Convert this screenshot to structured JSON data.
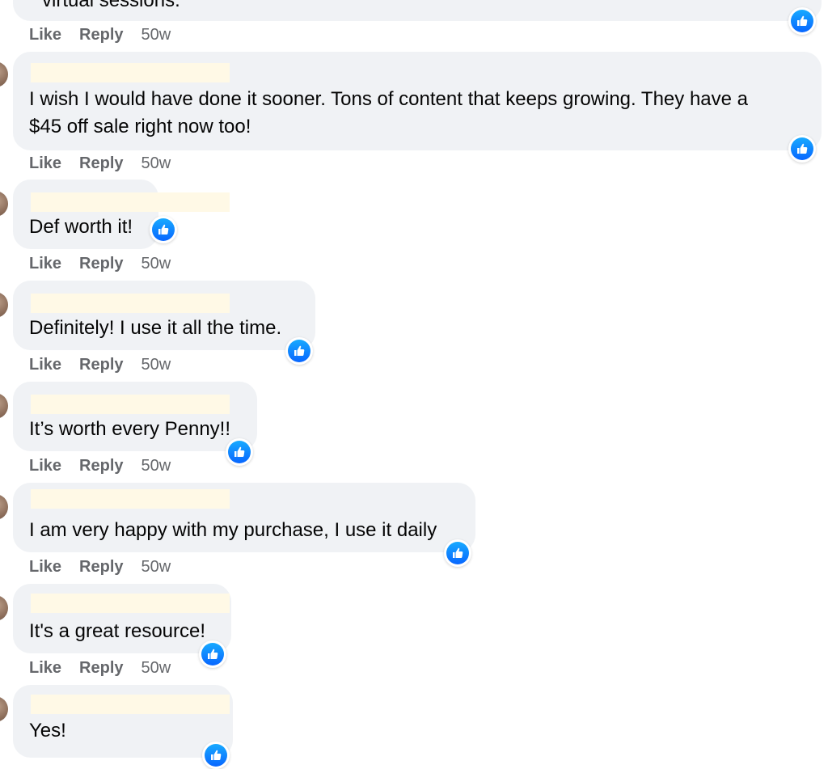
{
  "actions": {
    "like": "Like",
    "reply": "Reply"
  },
  "comments": [
    {
      "text": "virtual sessions.",
      "time": "50w"
    },
    {
      "text_lines": [
        "I wish I would have done it sooner. Tons of content that keeps growing. They have a",
        "$45 off sale right now too!"
      ],
      "time": "50w"
    },
    {
      "text": "Def worth it!",
      "time": "50w"
    },
    {
      "text": "Definitely! I use it all the time.",
      "time": "50w"
    },
    {
      "text": "It’s worth every Penny!!",
      "time": "50w"
    },
    {
      "text": "I am very happy with my purchase, I use it daily",
      "time": "50w"
    },
    {
      "text": "It's a great resource!",
      "time": "50w"
    },
    {
      "text": "Yes!",
      "time": ""
    }
  ],
  "icons": {
    "reaction": "like-thumbs-up-icon",
    "accent": "#0866ff",
    "bubble": "#f0f2f5",
    "meta_text": "#65676b"
  }
}
